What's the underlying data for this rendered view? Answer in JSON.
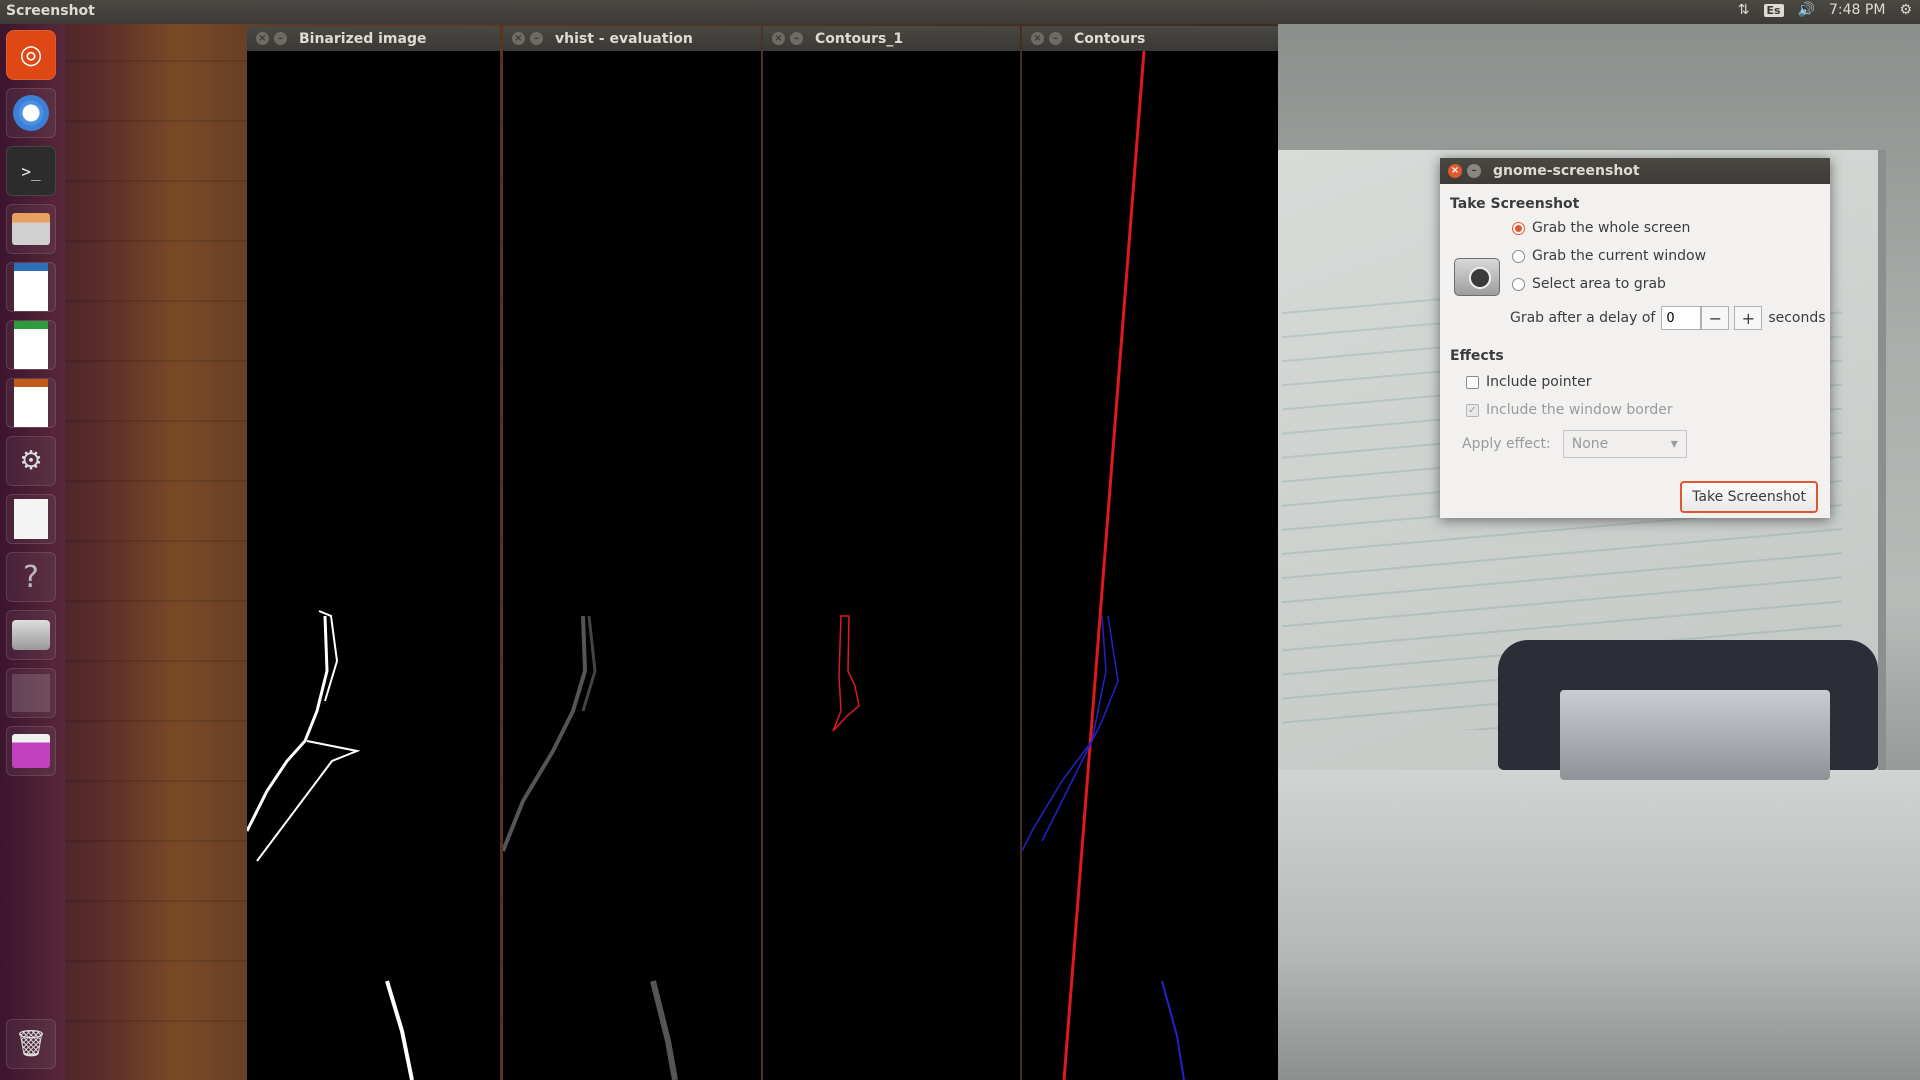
{
  "topbar": {
    "title": "Screenshot",
    "keyboard": "Es",
    "time": "7:48 PM"
  },
  "launcher": {
    "items": [
      "dash-icon",
      "chromium-icon",
      "terminal-icon",
      "files-icon",
      "writer-icon",
      "calc-icon",
      "impress-icon",
      "system-settings-icon",
      "text-editor-icon",
      "help-icon",
      "screenshot-icon",
      "workspace-switcher-icon",
      "window-icon",
      "trash-icon"
    ]
  },
  "windows": [
    {
      "title": "Binarized image"
    },
    {
      "title": "vhist - evaluation"
    },
    {
      "title": "Contours_1"
    },
    {
      "title": "Contours"
    }
  ],
  "dialog": {
    "title": "gnome-screenshot",
    "take_section": "Take Screenshot",
    "options": [
      "Grab the whole screen",
      "Grab the current window",
      "Select area to grab"
    ],
    "selected_option": "Grab the whole screen",
    "delay_label": "Grab after a delay of",
    "delay_value": "0",
    "delay_minus": "−",
    "delay_plus": "+",
    "delay_unit": "seconds",
    "effects_section": "Effects",
    "include_pointer": "Include pointer",
    "include_border": "Include the window border",
    "apply_effect_label": "Apply effect:",
    "apply_effect_value": "None",
    "take_button": "Take Screenshot"
  },
  "colors": {
    "accent": "#e0582f",
    "contour_red": "#e0191b",
    "contour_blue": "#2222cc"
  }
}
